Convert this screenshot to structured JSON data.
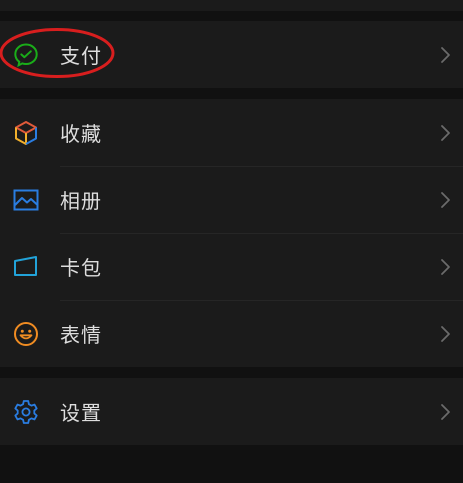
{
  "colors": {
    "background": "#111111",
    "row_background": "#1b1b1b",
    "text": "#dedede",
    "chevron": "#6b6b6b",
    "pay_icon": "#1aad19",
    "favorites_icon": "#e05a3a",
    "album_icon": "#2a7de1",
    "cards_icon": "#22a3d9",
    "stickers_icon": "#f08c22",
    "settings_icon": "#2a7de1",
    "annotation_circle": "#d81e1e"
  },
  "menu": {
    "pay": {
      "label": "支付",
      "icon": "wechat-pay-icon"
    },
    "favorites": {
      "label": "收藏",
      "icon": "cube-icon"
    },
    "album": {
      "label": "相册",
      "icon": "image-icon"
    },
    "cards": {
      "label": "卡包",
      "icon": "wallet-icon"
    },
    "stickers": {
      "label": "表情",
      "icon": "smiley-icon"
    },
    "settings": {
      "label": "设置",
      "icon": "gear-icon"
    }
  }
}
